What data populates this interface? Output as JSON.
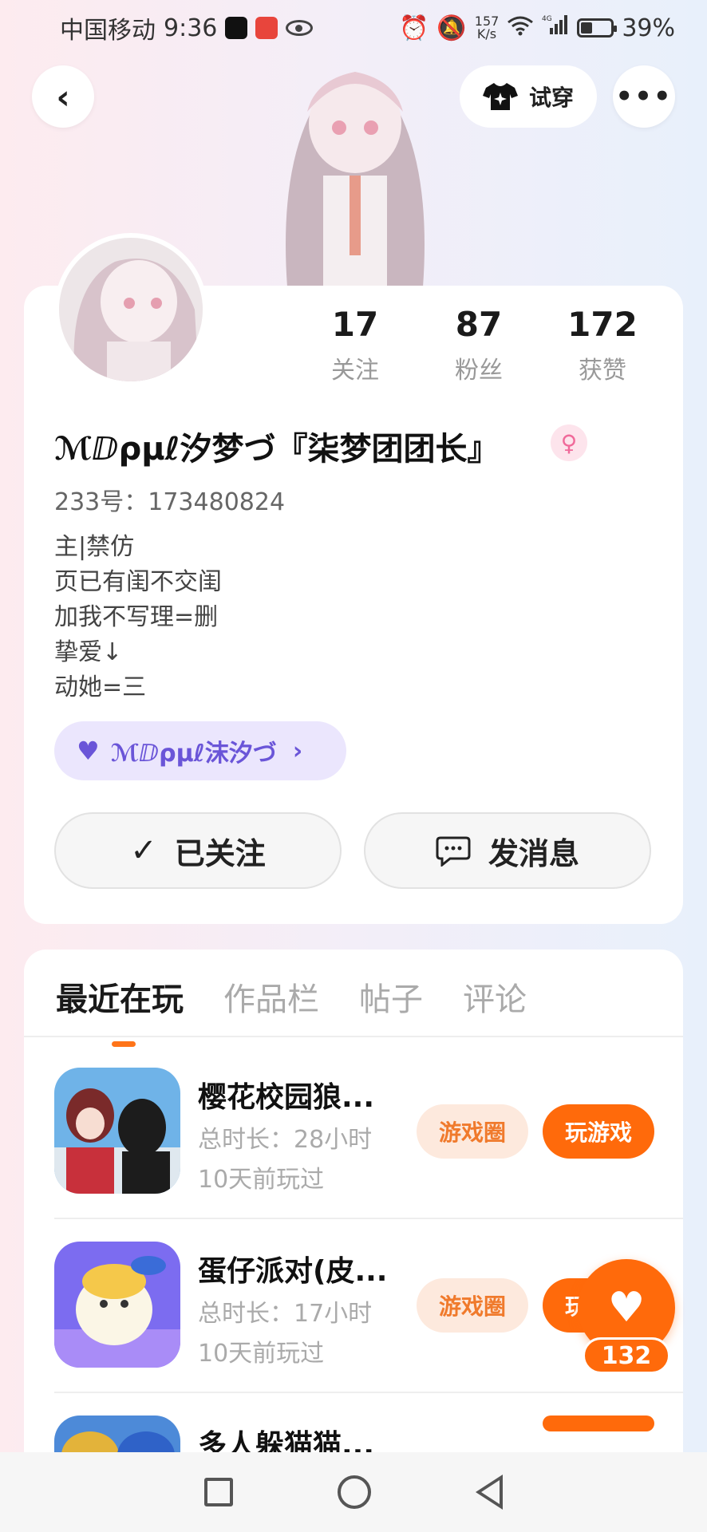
{
  "status_bar": {
    "carrier": "中国移动",
    "time": "9:36",
    "net_speed_value": "157",
    "net_speed_unit": "K/s",
    "network": "4G",
    "battery": "39%"
  },
  "header": {
    "try_on_label": "试穿",
    "back_icon": "chevron-left-icon",
    "more_icon": "more-dots-icon"
  },
  "profile": {
    "stats": [
      {
        "value": "17",
        "label": "关注"
      },
      {
        "value": "87",
        "label": "粉丝"
      },
      {
        "value": "172",
        "label": "获赞"
      }
    ],
    "nickname": "ℳⅅρμℓ汐梦づ『柒梦团团长』",
    "gender": "female",
    "uid": "233号：173480824",
    "bio": [
      "主|禁仿",
      "页已有闺不交闺",
      "加我不写理=删",
      "挚爱↓",
      "动她=三"
    ],
    "cp_tag": "ℳⅅρμℓ沫汐づ",
    "follow_label": "已关注",
    "message_label": "发消息"
  },
  "tabs": [
    {
      "label": "最近在玩",
      "active": true
    },
    {
      "label": "作品栏",
      "active": false
    },
    {
      "label": "帖子",
      "active": false
    },
    {
      "label": "评论",
      "active": false
    }
  ],
  "games": [
    {
      "name": "樱花校园狼...",
      "duration": "总时长：28小时",
      "last_played": "10天前玩过",
      "circle_label": "游戏圈",
      "play_label": "玩游戏"
    },
    {
      "name": "蛋仔派对(皮...",
      "duration": "总时长：17小时",
      "last_played": "10天前玩过",
      "circle_label": "游戏圈",
      "play_label": "玩游戏"
    },
    {
      "name": "多人躲猫猫...",
      "duration": "",
      "last_played": "",
      "circle_label": "",
      "play_label": ""
    }
  ],
  "like_fab": {
    "count": "132"
  },
  "colors": {
    "accent": "#ff6a0b",
    "accent_light": "#fde9dd",
    "cp_tag_bg": "#ebe6fd",
    "cp_tag_text": "#6a55d8"
  }
}
